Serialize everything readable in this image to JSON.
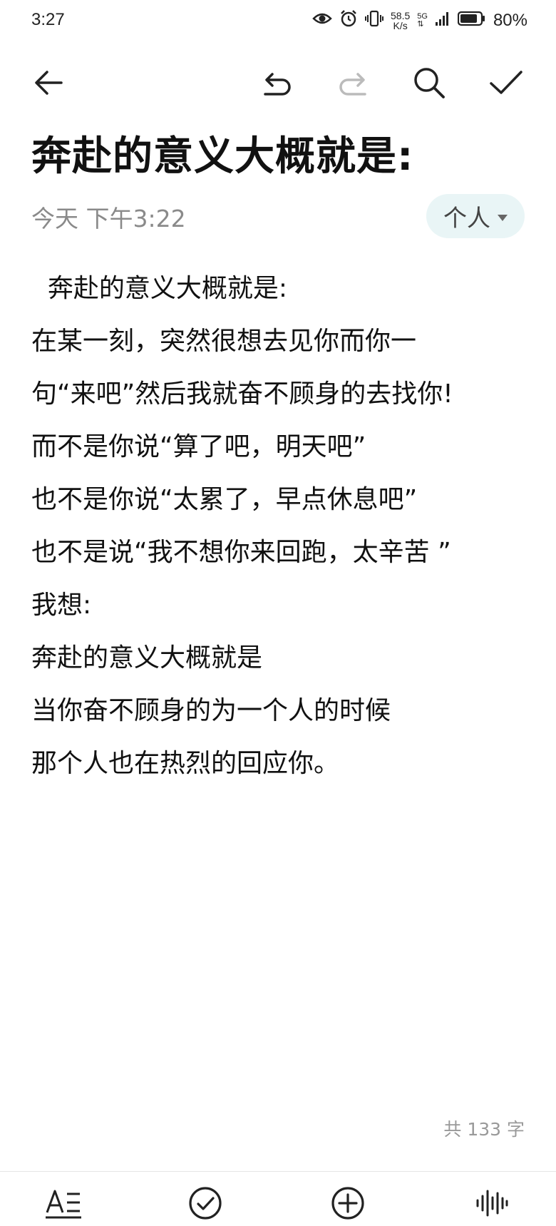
{
  "status_bar": {
    "time": "3:27",
    "net_speed_value": "58.5",
    "net_speed_unit": "K/s",
    "network_type": "5G",
    "battery": "80%"
  },
  "toolbar": {
    "icons": [
      "back-arrow-icon",
      "undo-icon",
      "redo-icon",
      "search-icon",
      "checkmark-icon"
    ]
  },
  "note": {
    "title": "奔赴的意义大概就是:",
    "date": "今天 下午3:22",
    "category": "个人",
    "lines": [
      "  奔赴的意义大概就是:",
      "在某一刻，突然很想去见你而你一",
      "句“来吧”然后我就奋不顾身的去找你!",
      "而不是你说“算了吧，明天吧”",
      "也不是你说“太累了，早点休息吧”",
      "也不是说“我不想你来回跑，太辛苦 ”",
      "我想:",
      "奔赴的意义大概就是",
      "当你奋不顾身的为一个人的时候",
      "那个人也在热烈的回应你。"
    ],
    "word_count": "共 133 字"
  },
  "bottom_bar": {
    "icons": [
      "text-format-icon",
      "checklist-icon",
      "add-icon",
      "voice-icon"
    ]
  },
  "colors": {
    "accent_chip": "#e9f5f6",
    "muted_text": "#8a8a8a"
  }
}
